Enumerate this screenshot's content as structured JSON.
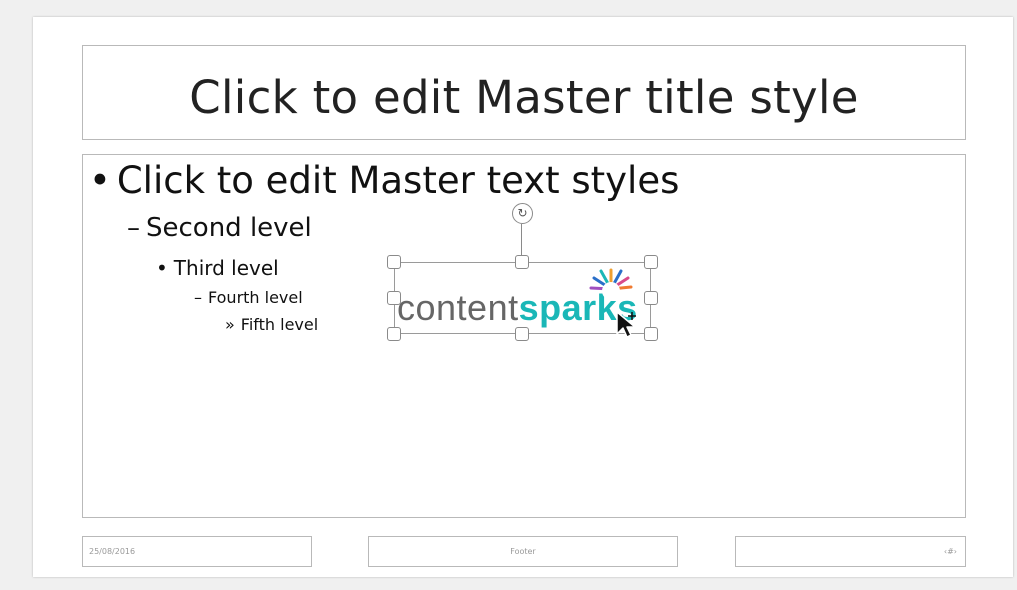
{
  "title_placeholder": {
    "text": "Click to edit Master title style"
  },
  "body_placeholder": {
    "levels": [
      {
        "bullet": "•",
        "text": "Click to edit Master text styles"
      },
      {
        "bullet": "–",
        "text": "Second level"
      },
      {
        "bullet": "•",
        "text": "Third level"
      },
      {
        "bullet": "–",
        "text": "Fourth level"
      },
      {
        "bullet": "»",
        "text": "Fifth level"
      }
    ]
  },
  "logo": {
    "part1": "content",
    "part2": "sparks",
    "colors": {
      "content": "#666666",
      "sparks": "#1ab7b7"
    },
    "icon": "sparks-burst-icon"
  },
  "footer": {
    "date": "25/08/2016",
    "center": "Footer",
    "slide_number": "‹#›"
  },
  "icons": {
    "rotate": "rotate-handle-icon",
    "cursor": "move-cursor-icon"
  }
}
